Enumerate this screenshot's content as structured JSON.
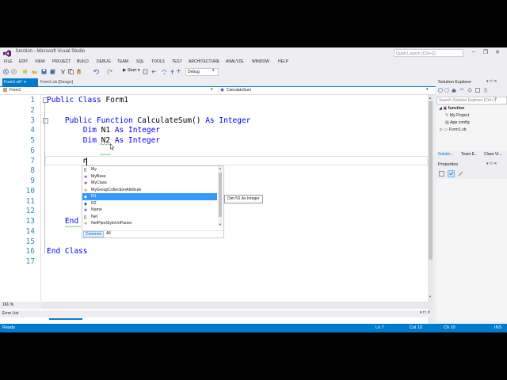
{
  "window": {
    "title": "function - Microsoft Visual Studio",
    "quick_launch_placeholder": "Quick Launch (Ctrl+Q)",
    "controls": [
      "–",
      "❐",
      "✕"
    ]
  },
  "menu": [
    "FILE",
    "EDIT",
    "VIEW",
    "PROJECT",
    "BUILD",
    "DEBUG",
    "TEAM",
    "SQL",
    "TOOLS",
    "TEST",
    "ARCHITECTURE",
    "ANALYZE",
    "WINDOW",
    "HELP"
  ],
  "toolbar": {
    "start_label": "▶ Start ▾",
    "configuration": "Debug"
  },
  "tabs": [
    {
      "label": "Form1.vb*  ✕",
      "active": true
    },
    {
      "label": "Form1.vb [Design]",
      "active": false
    }
  ],
  "nav": {
    "class_name": "Form1",
    "member_name": "CalculateSum"
  },
  "editor": {
    "lines": [
      {
        "n": "1",
        "code": [
          {
            "t": "Public Class",
            "k": true
          },
          {
            "t": " Form1"
          }
        ]
      },
      {
        "n": "2",
        "code": []
      },
      {
        "n": "3",
        "code": [
          {
            "t": "    "
          },
          {
            "t": "Public Function",
            "k": true
          },
          {
            "t": " CalculateSum() "
          },
          {
            "t": "As Integer",
            "k": true
          }
        ]
      },
      {
        "n": "4",
        "code": [
          {
            "t": "        "
          },
          {
            "t": "Dim",
            "k": true
          },
          {
            "t": " N1 "
          },
          {
            "t": "As Integer",
            "k": true
          }
        ]
      },
      {
        "n": "5",
        "code": [
          {
            "t": "        "
          },
          {
            "t": "Dim",
            "k": true
          },
          {
            "t": " N2 "
          },
          {
            "t": "As Integer",
            "k": true
          }
        ]
      },
      {
        "n": "6",
        "code": []
      },
      {
        "n": "7",
        "code": [
          {
            "t": "        n"
          }
        ]
      },
      {
        "n": "8",
        "code": []
      },
      {
        "n": "9",
        "code": []
      },
      {
        "n": "10",
        "code": []
      },
      {
        "n": "11",
        "code": []
      },
      {
        "n": "12",
        "code": []
      },
      {
        "n": "13",
        "code": [
          {
            "t": "    "
          },
          {
            "t": "End",
            "k": true
          }
        ]
      },
      {
        "n": "14",
        "code": []
      },
      {
        "n": "15",
        "code": []
      },
      {
        "n": "16",
        "code": [
          {
            "t": "End Class",
            "k": true
          }
        ]
      },
      {
        "n": "17",
        "code": []
      }
    ],
    "zoom": "161 %"
  },
  "intellisense": {
    "items": [
      {
        "icon": "{}",
        "label": "My"
      },
      {
        "icon": "✱",
        "label": "MyBase"
      },
      {
        "icon": "✱",
        "label": "MyClass"
      },
      {
        "icon": "✱",
        "label": "MyGroupCollectionAttribute"
      },
      {
        "icon": "◆",
        "label": "N1",
        "selected": true
      },
      {
        "icon": "◆",
        "label": "N2"
      },
      {
        "icon": "✱",
        "label": "Name"
      },
      {
        "icon": "{}",
        "label": "Net"
      },
      {
        "icon": "✱",
        "label": "NetPipeStyleUriParser"
      }
    ],
    "tabs": [
      "Common",
      "All"
    ],
    "tooltip": "Dim N1 As Integer"
  },
  "solution_explorer": {
    "title": "Solution Explorer",
    "search_placeholder": "Search Solution Explorer (Ctrl+;)",
    "tree": [
      {
        "label": "function",
        "depth": 0,
        "bold": true
      },
      {
        "label": "My Project",
        "depth": 1
      },
      {
        "label": "App.config",
        "depth": 1
      },
      {
        "label": "Form1.vb",
        "depth": 1
      }
    ],
    "tabs": [
      "Solutio...",
      "Team E...",
      "Class Vi..."
    ]
  },
  "properties": {
    "title": "Properties"
  },
  "error_list": {
    "title": "Error List"
  },
  "status": {
    "state": "Ready",
    "line": "Ln 7",
    "col": "Col 10",
    "ch": "Ch 10",
    "mode": "INS"
  }
}
